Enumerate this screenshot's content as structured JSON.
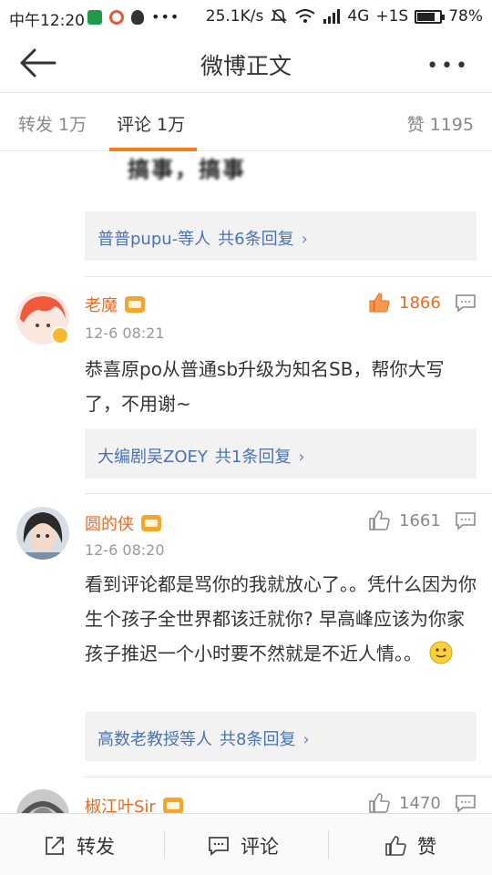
{
  "status_bar": {
    "time": "中午12:20",
    "net_speed": "25.1K/s",
    "network": "4G",
    "extra": "+1S",
    "battery": "78%",
    "battery_level": 0.78
  },
  "header": {
    "title": "微博正文"
  },
  "tabs": {
    "repost": "转发 1万",
    "comment": "评论 1万",
    "like": "赞 1195"
  },
  "partial_text": "搞事，搞事",
  "top_reply": {
    "users": "普普pupu-等人",
    "count": "共6条回复",
    "chevron": "›"
  },
  "comments": [
    {
      "user": "老魔",
      "time": "12-6 08:21",
      "text": "恭喜原po从普通sb升级为知名SB，帮你大写了，不用谢~",
      "likes": "1866",
      "reply_users": "大编剧吴ZOEY",
      "reply_count": "共1条回复",
      "chevron": "›"
    },
    {
      "user": "圆的侠",
      "time": "12-6 08:20",
      "text": "看到评论都是骂你的我就放心了。。凭什么因为你生个孩子全世界都该迁就你? 早高峰应该为你家孩子推迟一个小时要不然就是不近人情。。",
      "likes": "1661",
      "reply_users": "高数老教授等人",
      "reply_count": "共8条回复",
      "chevron": "›"
    },
    {
      "user": "椒江叶Sir",
      "likes": "1470"
    }
  ],
  "bottom_bar": {
    "repost": "转发",
    "comment": "评论",
    "like": "赞"
  },
  "colors": {
    "accent": "#fb7d16",
    "username": "#ea6a1f",
    "link": "#4a73b3"
  }
}
